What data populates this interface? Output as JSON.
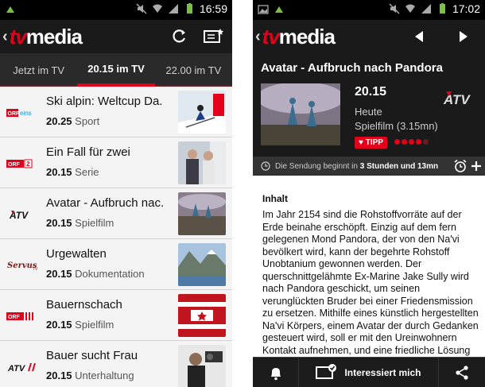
{
  "left": {
    "status": {
      "time": "16:59"
    },
    "appbar": {
      "logo_tv": "tv",
      "logo_media": "media",
      "refresh_icon": "refresh-icon",
      "watchlist_icon": "tv-star-icon"
    },
    "tabs": [
      "Jetzt im TV",
      "20.15 im TV",
      "22.00 im TV"
    ],
    "active_tab": 1,
    "rows": [
      {
        "channel": "ORF eins",
        "title": "Ski alpin: Weltcup Da.",
        "time": "20.25",
        "genre": "Sport"
      },
      {
        "channel": "ORF 2",
        "title": "Ein Fall für zwei",
        "time": "20.15",
        "genre": "Serie"
      },
      {
        "channel": "ATV",
        "title": "Avatar - Aufbruch nac.",
        "time": "20.15",
        "genre": "Spielfilm"
      },
      {
        "channel": "Servus TV",
        "title": "Urgewalten",
        "time": "20.15",
        "genre": "Dokumentation"
      },
      {
        "channel": "ORF III",
        "title": "Bauernschach",
        "time": "20.15",
        "genre": "Spielfilm"
      },
      {
        "channel": "ATV II",
        "title": "Bauer sucht Frau",
        "time": "20.15",
        "genre": "Unterhaltung"
      }
    ]
  },
  "right": {
    "status": {
      "time": "17:02"
    },
    "appbar": {
      "logo_tv": "tv",
      "logo_media": "media",
      "prev_icon": "arrow-left-icon",
      "next_icon": "arrow-right-icon"
    },
    "detail": {
      "title": "Avatar - Aufbruch nach Pandora",
      "time": "20.15",
      "day": "Heute",
      "genre": "Spielfilm (3.15mn)",
      "tipp": "♥ TIPP",
      "channel": "ATV",
      "rating": 4,
      "rating_max": 5,
      "notice_prefix": "Die Sendung beginnt in",
      "notice_value": "3 Stunden und 13mn"
    },
    "content": {
      "heading": "Inhalt",
      "text": "Im Jahr 2154 sind die Rohstoffvorräte auf der Erde beinahe erschöpft. Einzig auf dem fern gelegenen Mond Pandora, der von den Na'vi bevölkert wird, kann der begehrte Rohstoff Unobtanium gewonnen werden. Der querschnittgelähmte Ex-Marine Jake Sully wird nach Pandora geschickt, um seinen verunglückten Bruder bei einer Friedensmission zu ersetzen. Mithilfe eines künstlich hergestellten Na'vi Körpers, einem Avatar der durch Gedanken gesteuert wird, soll er mit den Ureinwohnern Kontakt aufnehmen, und eine friedliche Lösung für die"
    },
    "bottombar": {
      "interest_label": "Interessiert mich"
    }
  },
  "colors": {
    "accent": "#e2001a",
    "appbar": "#1a1a1a",
    "tabs": "#2a2a2a"
  }
}
